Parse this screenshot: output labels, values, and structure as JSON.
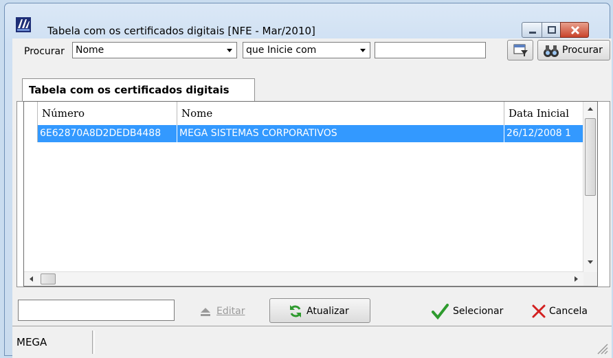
{
  "window": {
    "title": "Tabela com os certificados digitais [NFE - Mar/2010]"
  },
  "search": {
    "label": "Procurar",
    "field_value": "Nome",
    "condition_value": "que Inicie com",
    "input_value": "",
    "search_button_label": "Procurar"
  },
  "tab": {
    "label": "Tabela com os certificados digitais"
  },
  "grid": {
    "columns": [
      "Número",
      "Nome",
      "Data Inicial"
    ],
    "rows": [
      [
        "6E62870A8D2DEDB4488",
        "MEGA SISTEMAS CORPORATIVOS",
        "26/12/2008 1"
      ]
    ],
    "selection_color": "#3399ff"
  },
  "actions": {
    "edit_label": "Editar",
    "refresh_label": "Atualizar",
    "select_label": "Selecionar",
    "cancel_label": "Cancela"
  },
  "status": {
    "left_text": "MEGA"
  },
  "icons": [
    "app-logo-icon",
    "minimize-icon",
    "maximize-icon",
    "close-icon",
    "dropdown-arrow-icon",
    "filter-icon",
    "binoculars-icon",
    "eject-icon",
    "refresh-icon",
    "checkmark-icon",
    "x-icon",
    "resize-grip-icon"
  ]
}
